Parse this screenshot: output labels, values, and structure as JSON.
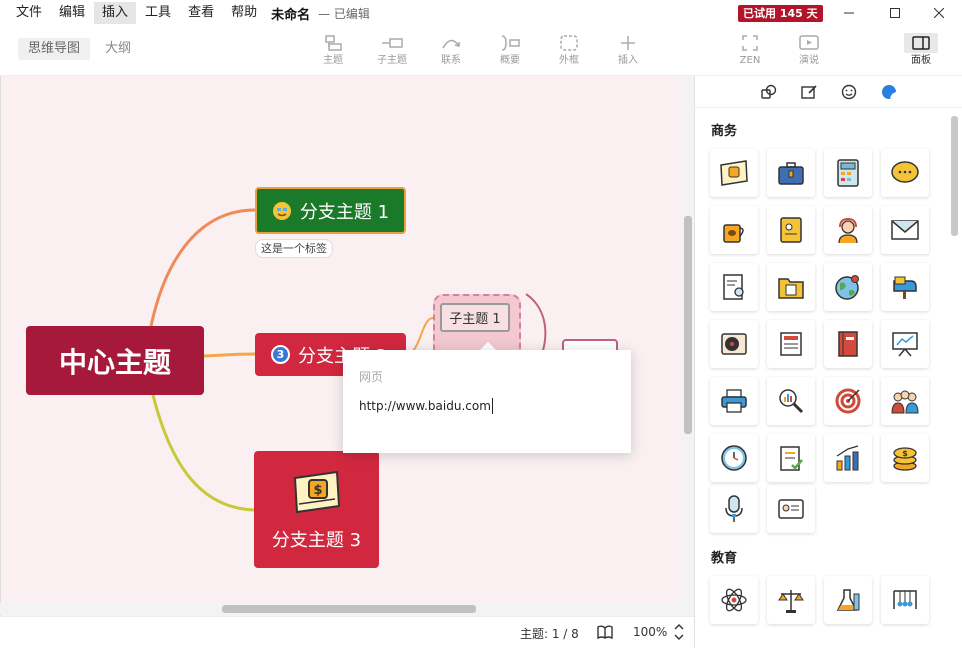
{
  "menu": {
    "items": [
      "文件",
      "编辑",
      "插入",
      "工具",
      "查看",
      "帮助"
    ],
    "active_index": 2,
    "doc_title": "未命名",
    "doc_status": "— 已编辑",
    "trial_badge": "已试用 145 天"
  },
  "toolbar": {
    "view_tabs": [
      "思维导图",
      "大纲"
    ],
    "tools": [
      "主题",
      "子主题",
      "联系",
      "概要",
      "外框",
      "插入"
    ],
    "right_tools": [
      "ZEN",
      "演说"
    ],
    "panel_label": "面板"
  },
  "map": {
    "central": "中心主题",
    "branch1": "分支主题 1",
    "branch1_label": "这是一个标签",
    "branch2": "分支主题 2",
    "branch2_marker": "3",
    "branch3": "分支主题 3",
    "subtopic1": "子主题 1"
  },
  "popup": {
    "label": "网页",
    "value": "http://www.baidu.com"
  },
  "status": {
    "topic_count": "主题: 1 / 8",
    "zoom": "100%"
  },
  "panel": {
    "sections": [
      {
        "title": "商务",
        "stickers": [
          "money-icon",
          "briefcase-icon",
          "calculator-icon",
          "chat-bubble-icon",
          "coffee-icon",
          "contact-book-icon",
          "support-agent-icon",
          "envelope-icon",
          "document-search-icon",
          "folder-icon",
          "globe-location-icon",
          "mailbox-icon",
          "record-player-icon",
          "newspaper-icon",
          "book-icon",
          "presentation-icon",
          "printer-icon",
          "magnifier-chart-icon",
          "target-icon",
          "team-icon",
          "clock-icon",
          "checklist-icon",
          "growth-chart-icon",
          "coins-icon",
          "microphone-icon",
          "id-card-icon"
        ]
      },
      {
        "title": "教育",
        "stickers": [
          "atom-icon",
          "scales-icon",
          "flask-icon",
          "newton-cradle-icon"
        ]
      }
    ]
  },
  "colors": {
    "central": "#a7193b",
    "branch1": "#1a7a2a",
    "branch2": "#d1283f",
    "branch3": "#d1283f",
    "canvas_bg": "#faf0f1",
    "trial": "#b4142a"
  }
}
